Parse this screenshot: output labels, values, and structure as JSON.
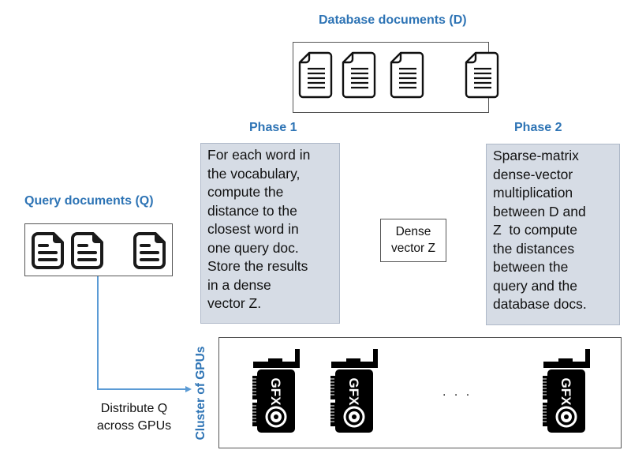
{
  "database": {
    "title": "Database documents (D)",
    "icons": [
      "document-lines-icon",
      "document-lines-icon",
      "document-lines-icon",
      "document-lines-icon"
    ]
  },
  "query": {
    "title": "Query documents (Q)",
    "icons": [
      "document-icon",
      "document-icon",
      "document-icon"
    ]
  },
  "phase1": {
    "title": "Phase 1",
    "lines": [
      "For each word in",
      "the vocabulary,",
      "compute the",
      "distance to the",
      "closest word in",
      "one query doc.",
      "Store the results",
      "in a dense",
      "vector Z."
    ]
  },
  "phase2": {
    "title": "Phase 2",
    "lines": [
      "Sparse-matrix",
      "dense-vector",
      "multiplication",
      "between D and",
      "Z  to compute",
      "the distances",
      "between the",
      "query and the",
      "database docs."
    ]
  },
  "dense_vector": {
    "lines": [
      "Dense",
      "vector Z"
    ]
  },
  "cluster": {
    "label": "Cluster of GPUs",
    "gpu_label": "GFX",
    "ellipsis": ". . .",
    "icons": [
      "gpu-card-icon",
      "gpu-card-icon",
      "gpu-card-icon"
    ]
  },
  "distribute": {
    "lines": [
      "Distribute Q",
      "across GPUs"
    ]
  },
  "colors": {
    "accent": "#2e74b5",
    "phase_fill": "#d6dce5",
    "connector": "#5b9bd5"
  }
}
